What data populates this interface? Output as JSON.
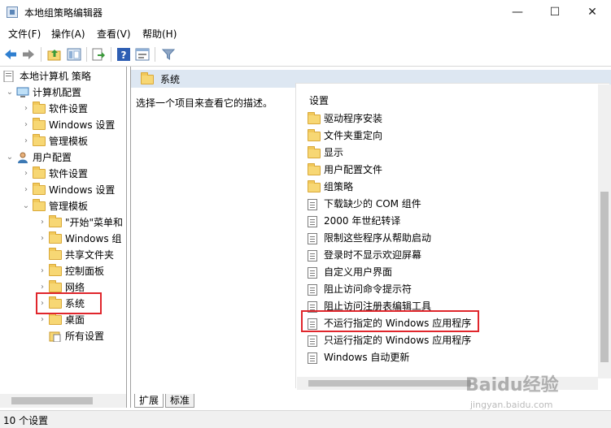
{
  "window": {
    "title": "本地组策略编辑器",
    "minimize_glyph": "—",
    "maximize_glyph": "☐",
    "close_glyph": "✕"
  },
  "menu": {
    "items": [
      {
        "label": "文件(F)"
      },
      {
        "label": "操作(A)"
      },
      {
        "label": "查看(V)"
      },
      {
        "label": "帮助(H)"
      }
    ]
  },
  "toolbar": {
    "icons": [
      "back-arrow-icon",
      "forward-arrow-icon",
      "folder-up-icon",
      "show-hide-tree-icon",
      "export-list-icon",
      "help-icon",
      "properties-icon",
      "filter-icon"
    ]
  },
  "tree": {
    "root": "本地计算机 策略",
    "computer_config": "计算机配置",
    "c_software": "软件设置",
    "c_windows": "Windows 设置",
    "c_admin": "管理模板",
    "user_config": "用户配置",
    "u_software": "软件设置",
    "u_windows": "Windows 设置",
    "u_admin": "管理模板",
    "start_menu": "\"开始\"菜单和",
    "windows_comp": "Windows 组",
    "shared_folders": "共享文件夹",
    "control_panel": "控制面板",
    "network": "网络",
    "system": "系统",
    "desktop": "桌面",
    "all_settings": "所有设置"
  },
  "content": {
    "header_title": "系统",
    "description": "选择一个项目来查看它的描述。",
    "column_header": "设置",
    "rows": [
      {
        "type": "folder",
        "label": "驱动程序安装"
      },
      {
        "type": "folder",
        "label": "文件夹重定向"
      },
      {
        "type": "folder",
        "label": "显示"
      },
      {
        "type": "folder",
        "label": "用户配置文件"
      },
      {
        "type": "folder",
        "label": "组策略"
      },
      {
        "type": "setting",
        "label": "下载缺少的 COM 组件"
      },
      {
        "type": "setting",
        "label": "2000 年世纪转译"
      },
      {
        "type": "setting",
        "label": "限制这些程序从帮助启动"
      },
      {
        "type": "setting",
        "label": "登录时不显示欢迎屏幕"
      },
      {
        "type": "setting",
        "label": "自定义用户界面"
      },
      {
        "type": "setting",
        "label": "阻止访问命令提示符"
      },
      {
        "type": "setting",
        "label": "阻止访问注册表编辑工具"
      },
      {
        "type": "setting",
        "label": "不运行指定的 Windows 应用程序"
      },
      {
        "type": "setting",
        "label": "只运行指定的 Windows 应用程序"
      },
      {
        "type": "setting",
        "label": "Windows 自动更新"
      }
    ]
  },
  "tabs": [
    {
      "label": "扩展"
    },
    {
      "label": "标准"
    }
  ],
  "status": {
    "text": "10 个设置"
  },
  "watermark": {
    "logo": "Baidu经验",
    "url": "jingyan.baidu.com"
  },
  "colors": {
    "highlight": "#e0262c",
    "header_bg": "#dde7f2"
  }
}
